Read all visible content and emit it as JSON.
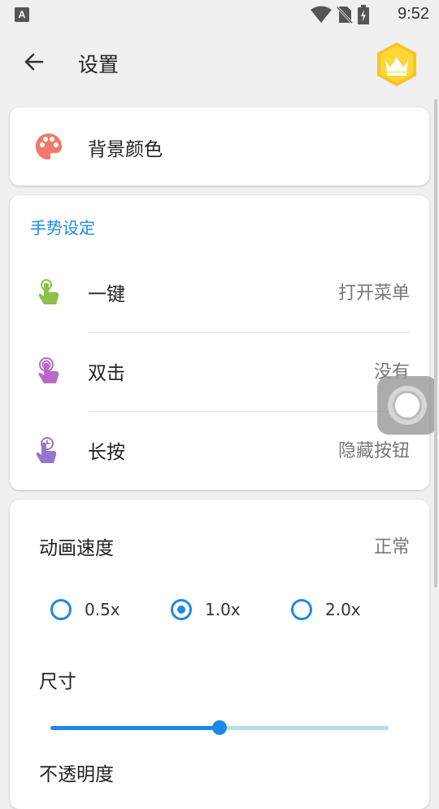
{
  "status_bar": {
    "time": "9:52",
    "notification_icon": "A"
  },
  "header": {
    "title": "设置"
  },
  "background_card": {
    "label": "背景颜色"
  },
  "gesture_card": {
    "section_title": "手势设定",
    "items": [
      {
        "label": "一键",
        "value": "打开菜单",
        "icon": "tap-hand-icon",
        "icon_color": "#8bc34a"
      },
      {
        "label": "双击",
        "value": "没有",
        "icon": "double-tap-hand-icon",
        "icon_color": "#ba68c8"
      },
      {
        "label": "长按",
        "value": "隐藏按钮",
        "icon": "long-press-hand-icon",
        "icon_color": "#9575cd"
      }
    ]
  },
  "animation_card": {
    "speed_label": "动画速度",
    "speed_value": "正常",
    "speed_options": [
      "0.5x",
      "1.0x",
      "2.0x"
    ],
    "selected_speed": "1.0x",
    "size_label": "尺寸",
    "size_fraction": 0.5,
    "opacity_label": "不透明度"
  },
  "colors": {
    "accent": "#1e88e5",
    "palette_icon": "#ef7b6b"
  }
}
